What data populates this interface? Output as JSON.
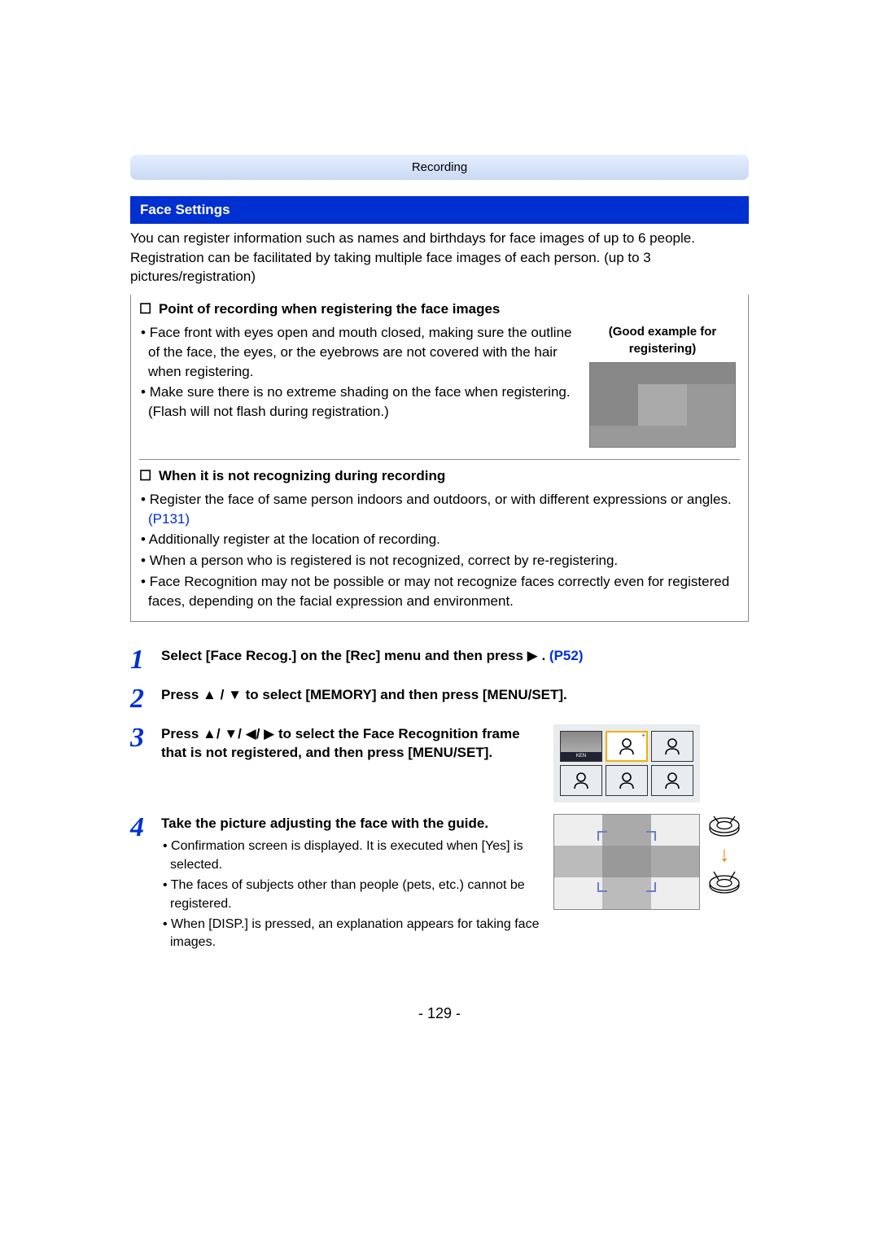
{
  "header_tab": "Recording",
  "section_title": "Face Settings",
  "intro": "You can register information such as names and birthdays for face images of up to 6 people. Registration can be facilitated by taking multiple face images of each person. (up to 3 pictures/registration)",
  "sub1_title": "Point of recording when registering the face images",
  "good_example_label": "(Good example for registering)",
  "sub1_items": [
    "Face front with eyes open and mouth closed, making sure the outline of the face, the eyes, or the eyebrows are not covered with the hair when registering.",
    "Make sure there is no extreme shading on the face when registering. (Flash will not flash during registration.)"
  ],
  "sub2_title": "When it is not recognizing during recording",
  "sub2_items": [
    {
      "text": "Register the face of same person indoors and outdoors, or with different expressions or angles.",
      "link": "(P131)"
    },
    {
      "text": "Additionally register at the location of recording."
    },
    {
      "text": "When a person who is registered is not recognized, correct by re-registering."
    },
    {
      "text": "Face Recognition may not be possible or may not recognize faces correctly even for registered faces, depending on the facial expression and environment."
    }
  ],
  "steps": {
    "s1": {
      "text_a": "Select [Face Recog.] on the [Rec] menu and then press ",
      "arrow": "▶",
      "dot": ". ",
      "link": "(P52)"
    },
    "s2": {
      "t1": "Press ",
      "a1": "▲",
      "sep": "/",
      "a2": "▼",
      "t2": " to select [MEMORY] and then press [MENU/SET]."
    },
    "s3": {
      "t1": "Press ",
      "a1": "▲",
      "a2": "▼",
      "a3": "◀",
      "a4": "▶",
      "t2": " to select the Face Recognition frame that is not registered, and then press [MENU/SET]."
    },
    "s4": {
      "title": "Take the picture adjusting the face with the guide.",
      "bullets": [
        "Confirmation screen is displayed. It is executed when [Yes] is selected.",
        "The faces of subjects other than people (pets, etc.) cannot be registered.",
        "When [DISP.] is pressed, an explanation appears for taking face images."
      ]
    }
  },
  "ken_label": "KEN",
  "page_number": "- 129 -"
}
